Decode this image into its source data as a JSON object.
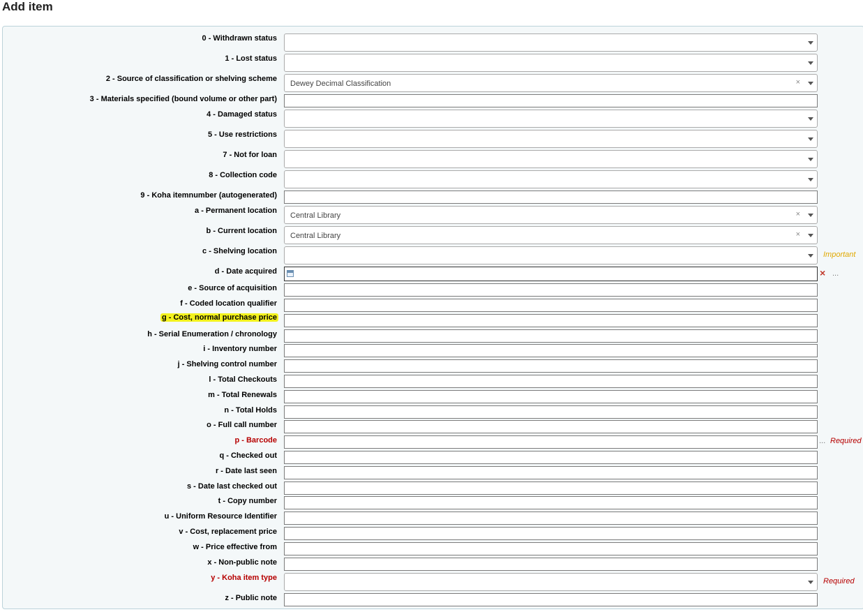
{
  "page": {
    "title": "Add item"
  },
  "fields": {
    "f0": {
      "label": "0 - Withdrawn status",
      "value": ""
    },
    "f1": {
      "label": "1 - Lost status",
      "value": ""
    },
    "f2": {
      "label": "2 - Source of classification or shelving scheme",
      "value": "Dewey Decimal Classification"
    },
    "f3": {
      "label": "3 - Materials specified (bound volume or other part)",
      "value": ""
    },
    "f4": {
      "label": "4 - Damaged status",
      "value": ""
    },
    "f5": {
      "label": "5 - Use restrictions",
      "value": ""
    },
    "f7": {
      "label": "7 - Not for loan",
      "value": ""
    },
    "f8": {
      "label": "8 - Collection code",
      "value": ""
    },
    "f9": {
      "label": "9 - Koha itemnumber (autogenerated)",
      "value": ""
    },
    "fa": {
      "label": "a - Permanent location",
      "value": "Central Library"
    },
    "fb": {
      "label": "b - Current location",
      "value": "Central Library"
    },
    "fc": {
      "label": "c - Shelving location",
      "value": "",
      "note": "Important"
    },
    "fd": {
      "label": "d - Date acquired",
      "value": "",
      "clear_icon": "×",
      "more": "..."
    },
    "fe": {
      "label": "e - Source of acquisition",
      "value": ""
    },
    "ff": {
      "label": "f - Coded location qualifier",
      "value": ""
    },
    "fg": {
      "label": "g - Cost, normal purchase price",
      "value": ""
    },
    "fh": {
      "label": "h - Serial Enumeration / chronology",
      "value": ""
    },
    "fi": {
      "label": "i - Inventory number",
      "value": ""
    },
    "fj": {
      "label": "j - Shelving control number",
      "value": ""
    },
    "fl": {
      "label": "l - Total Checkouts",
      "value": ""
    },
    "fm": {
      "label": "m - Total Renewals",
      "value": ""
    },
    "fn": {
      "label": "n - Total Holds",
      "value": ""
    },
    "fo": {
      "label": "o - Full call number",
      "value": ""
    },
    "fp": {
      "label": "p - Barcode",
      "value": "",
      "note": "Required",
      "more": "..."
    },
    "fq": {
      "label": "q - Checked out",
      "value": ""
    },
    "fr": {
      "label": "r - Date last seen",
      "value": ""
    },
    "fs": {
      "label": "s - Date last checked out",
      "value": ""
    },
    "ft": {
      "label": "t - Copy number",
      "value": ""
    },
    "fu": {
      "label": "u - Uniform Resource Identifier",
      "value": ""
    },
    "fv": {
      "label": "v - Cost, replacement price",
      "value": ""
    },
    "fw": {
      "label": "w - Price effective from",
      "value": ""
    },
    "fx": {
      "label": "x - Non-public note",
      "value": ""
    },
    "fy": {
      "label": "y - Koha item type",
      "value": "",
      "note": "Required"
    },
    "fz": {
      "label": "z - Public note",
      "value": ""
    }
  },
  "icons": {
    "select_arrow": "chevron-down-icon",
    "select_clear": "×",
    "calendar": "calendar-icon"
  },
  "colors": {
    "required": "#b60000",
    "important": "#e0a800",
    "highlight": "#f3f21d",
    "panel_background": "#f4f8f9"
  }
}
